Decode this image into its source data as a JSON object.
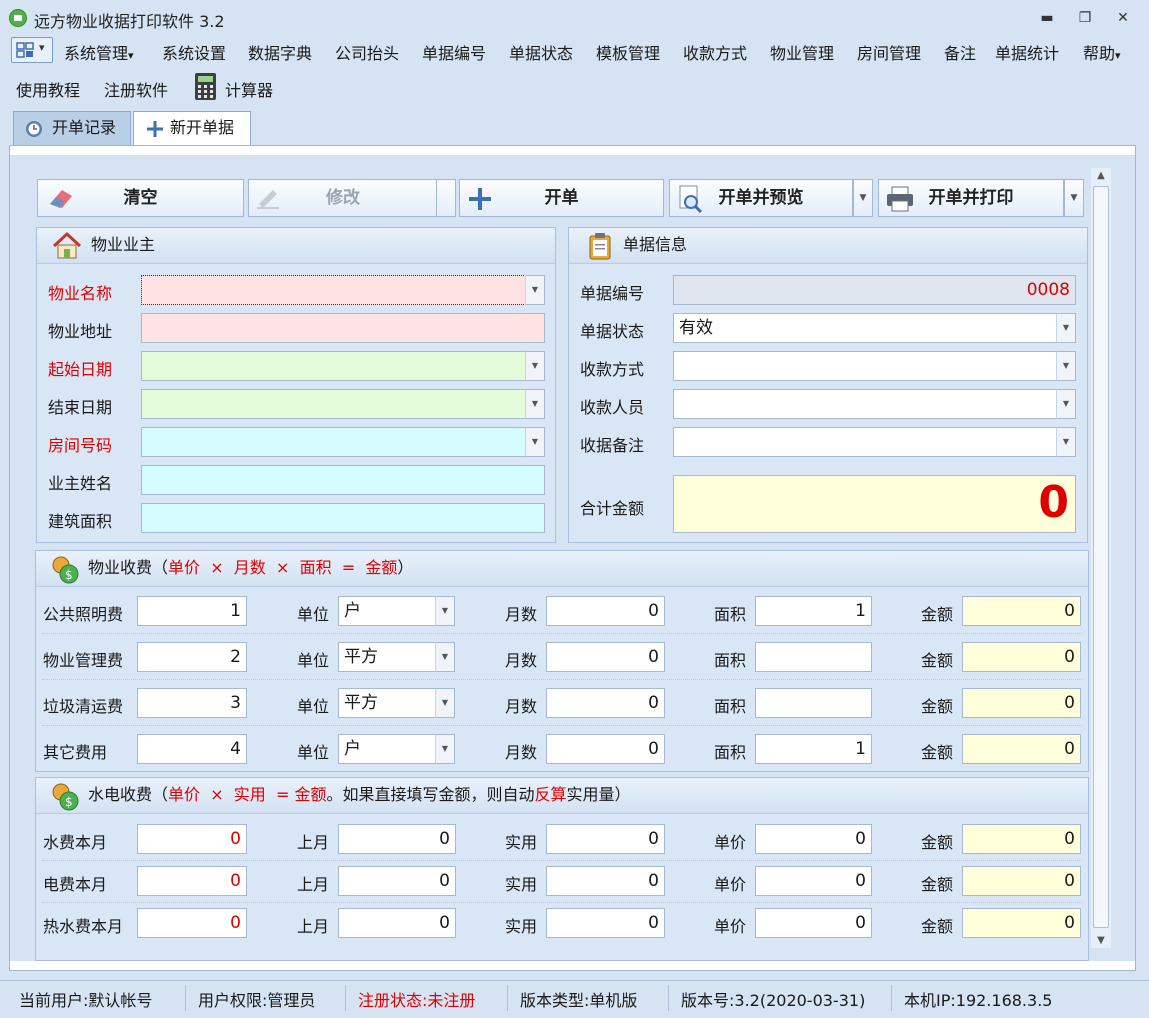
{
  "window": {
    "title": "远方物业收据打印软件 3.2",
    "minimize": "▬",
    "restore": "❐",
    "close": "✕"
  },
  "menu": {
    "items": [
      "系统管理",
      "系统设置",
      "数据字典",
      "公司抬头",
      "单据编号",
      "单据状态",
      "模板管理",
      "收款方式",
      "物业管理",
      "房间管理",
      "备注",
      "单据统计",
      "帮助"
    ],
    "dropdown_marker": "▾",
    "row2": [
      "使用教程",
      "注册软件",
      "计算器"
    ]
  },
  "tabs": [
    {
      "label": "开单记录"
    },
    {
      "label": "新开单据"
    }
  ],
  "toolbar": {
    "clear": "清空",
    "edit": "修改",
    "create": "开单",
    "create_preview": "开单并预览",
    "create_print": "开单并打印"
  },
  "owner": {
    "header": "物业业主",
    "labels": {
      "property_name": "物业名称",
      "address": "物业地址",
      "start_date": "起始日期",
      "end_date": "结束日期",
      "room": "房间号码",
      "owner_name": "业主姓名",
      "area": "建筑面积"
    },
    "values": {
      "property_name": "",
      "address": "",
      "start_date": "",
      "end_date": "",
      "room": "",
      "owner_name": "",
      "area": ""
    }
  },
  "receipt": {
    "header": "单据信息",
    "labels": {
      "number": "单据编号",
      "status": "单据状态",
      "payment": "收款方式",
      "collector": "收款人员",
      "note": "收据备注",
      "total": "合计金额"
    },
    "values": {
      "number": "0008",
      "status": "有效",
      "payment": "",
      "collector": "",
      "note": "",
      "total": "0"
    }
  },
  "fees": {
    "header": "物业收费",
    "formula": {
      "open": "（",
      "price": "单价",
      "times": "×",
      "months": "月数",
      "area": "面积",
      "eq": "=",
      "amount": "金额",
      "close": "）"
    },
    "labels": {
      "unit": "单位",
      "months": "月数",
      "area": "面积",
      "amount": "金额"
    },
    "rows": [
      {
        "name": "公共照明费",
        "price": "1",
        "unit": "户",
        "months": "0",
        "area": "1",
        "amount": "0"
      },
      {
        "name": "物业管理费",
        "price": "2",
        "unit": "平方",
        "months": "0",
        "area": "",
        "amount": "0"
      },
      {
        "name": "垃圾清运费",
        "price": "3",
        "unit": "平方",
        "months": "0",
        "area": "",
        "amount": "0"
      },
      {
        "name": "其它费用",
        "price": "4",
        "unit": "户",
        "months": "0",
        "area": "1",
        "amount": "0"
      }
    ]
  },
  "utilities": {
    "header": "水电收费",
    "formula": {
      "open": "（",
      "price": "单价",
      "times": "×",
      "usage": "实用",
      "eq": "=",
      "amount": "金额",
      "mid": "。如果直接填写金额，则自动",
      "reverse": "反算",
      "tail": "实用量）"
    },
    "labels": {
      "last": "上月",
      "usage": "实用",
      "price": "单价",
      "amount": "金额"
    },
    "rows": [
      {
        "name": "水费本月",
        "current": "0",
        "last": "0",
        "usage": "0",
        "price": "0",
        "amount": "0"
      },
      {
        "name": "电费本月",
        "current": "0",
        "last": "0",
        "usage": "0",
        "price": "0",
        "amount": "0"
      },
      {
        "name": "热水费本月",
        "current": "0",
        "last": "0",
        "usage": "0",
        "price": "0",
        "amount": "0"
      }
    ]
  },
  "status": {
    "user": "当前用户:默认帐号",
    "role": "用户权限:管理员",
    "registration": "注册状态:未注册",
    "edition": "版本类型:单机版",
    "version": "版本号:3.2(2020-03-31)",
    "ip": "本机IP:192.168.3.5"
  },
  "colors": {
    "required_label": "#e00000",
    "accent": "#d5e3f3"
  }
}
